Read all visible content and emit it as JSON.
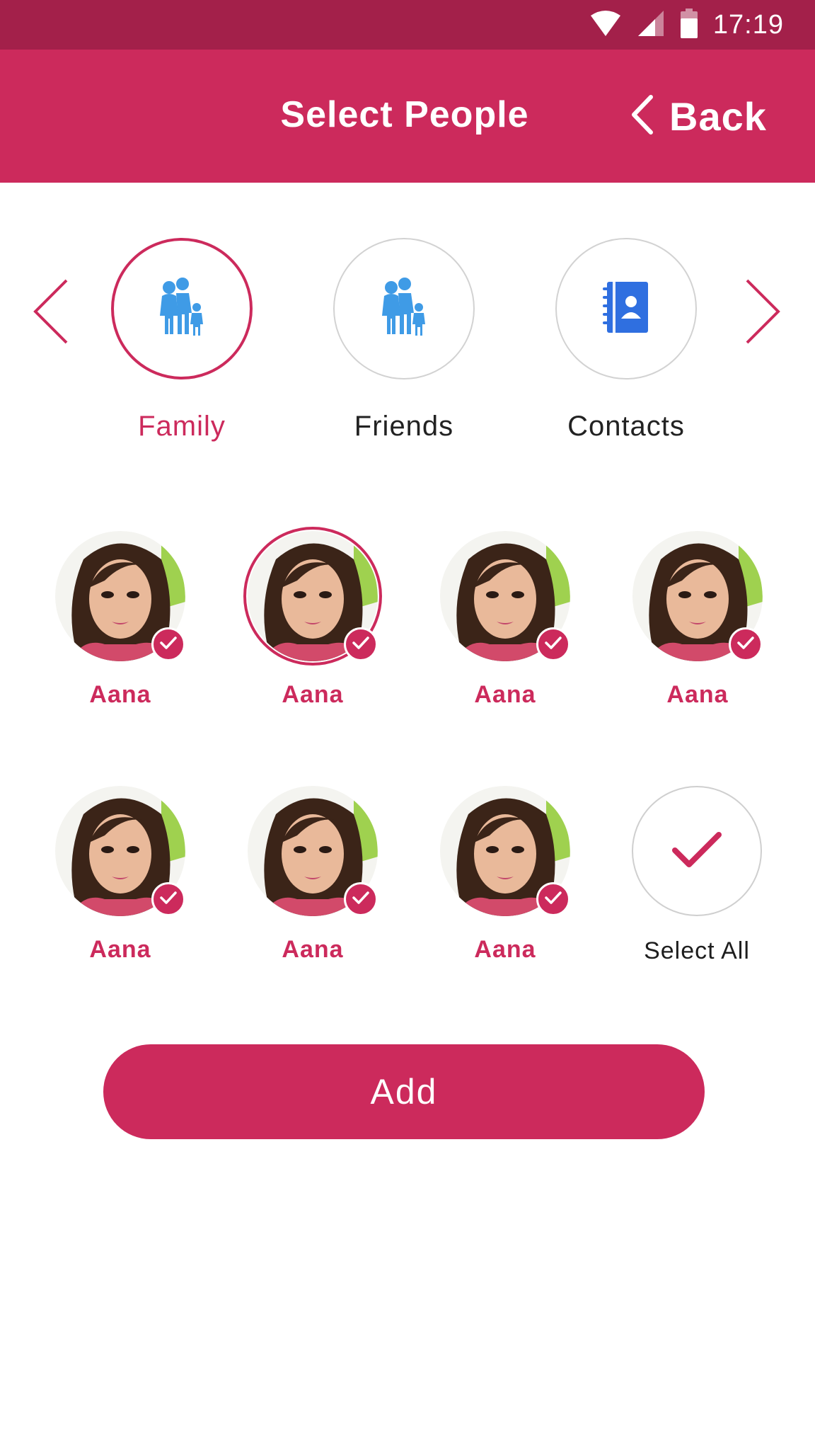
{
  "status_bar": {
    "time": "17:19",
    "icons": [
      "wifi-icon",
      "signal-icon",
      "battery-icon"
    ]
  },
  "header": {
    "title": "Select People",
    "back_label": "Back",
    "back_icon": "chevron-left-icon"
  },
  "categories": {
    "prev_icon": "chevron-left-icon",
    "next_icon": "chevron-right-icon",
    "items": [
      {
        "label": "Family",
        "icon": "family-icon",
        "selected": true
      },
      {
        "label": "Friends",
        "icon": "family-icon",
        "selected": false
      },
      {
        "label": "Contacts",
        "icon": "contact-book-icon",
        "selected": false
      }
    ]
  },
  "people": [
    {
      "name": "Aana",
      "checked": true
    },
    {
      "name": "Aana",
      "checked": true,
      "highlighted": true
    },
    {
      "name": "Aana",
      "checked": true
    },
    {
      "name": "Aana",
      "checked": true
    },
    {
      "name": "Aana",
      "checked": true
    },
    {
      "name": "Aana",
      "checked": true
    },
    {
      "name": "Aana",
      "checked": true
    }
  ],
  "select_all": {
    "label": "Select All",
    "icon": "checkmark-icon"
  },
  "actions": {
    "add_label": "Add"
  },
  "colors": {
    "status_bar": "#a3204a",
    "primary": "#cc2a5c",
    "icon_blue": "#3f9be6",
    "contacts_blue": "#2f6fe0"
  }
}
